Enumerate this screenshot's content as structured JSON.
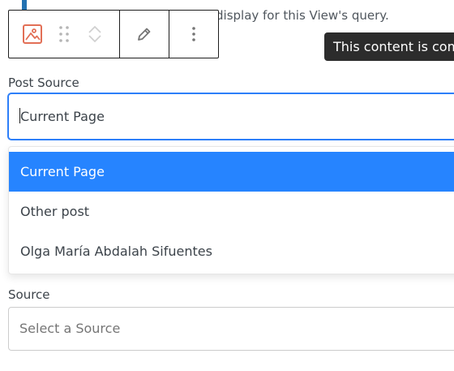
{
  "help_text": "display for this View's query.",
  "tooltip": "This content is com",
  "toolbar": {
    "block_icon": "image-icon",
    "drag_icon": "drag-handle-icon",
    "move_up_icon": "chevron-up-icon",
    "move_down_icon": "chevron-down-icon",
    "edit_icon": "pencil-icon",
    "options_icon": "more-vertical-icon"
  },
  "post_source": {
    "label": "Post Source",
    "value": "Current Page",
    "options": [
      "Current Page",
      "Other post",
      "Olga María Abdalah Sifuentes"
    ],
    "selected_index": 0
  },
  "source": {
    "label": "Source",
    "placeholder": "Select a Source"
  },
  "colors": {
    "accent": "#2271b1",
    "focus_border": "#2d7ff9",
    "selected_option": "#2684ff",
    "block_icon": "#e26f56",
    "tooltip_bg": "#2c2c2c"
  }
}
